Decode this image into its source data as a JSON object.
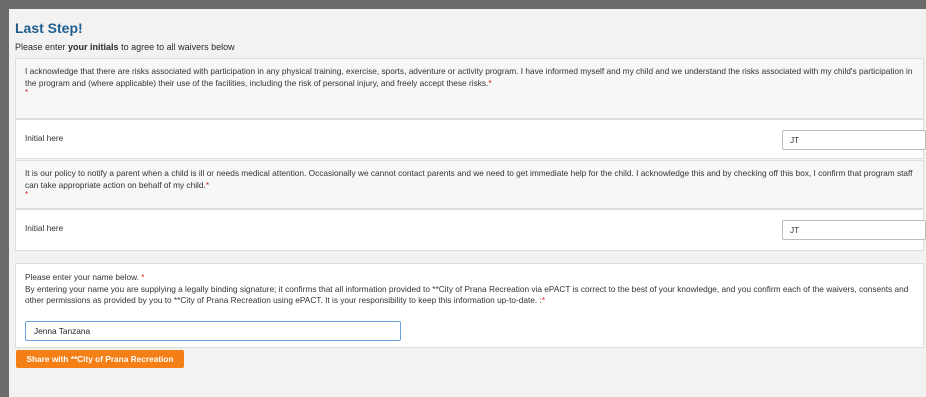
{
  "page": {
    "title": "Last Step!",
    "subtitle_prefix": "Please enter ",
    "subtitle_bold": "your initials",
    "subtitle_suffix": " to agree to all waivers below"
  },
  "waivers": [
    {
      "text": "I acknowledge that there are risks associated with participation in any physical training, exercise, sports, adventure or activity program. I have informed myself and my child and we understand the risks associated with my child's participation in the program and (where applicable) their use of the facilities, including the risk of personal injury, and freely accept these risks.",
      "required_marker": "*",
      "initial_label": "Initial here",
      "initial_value": "JT"
    },
    {
      "text": "It is our policy to notify a parent when a child is ill or needs medical attention. Occasionally we cannot contact parents and we need to get immediate help for the child. I acknowledge this and by checking off this box,  I confirm that program staff can take appropriate action on behalf of my child.",
      "required_marker": "*",
      "initial_label": "Initial here",
      "initial_value": "JT"
    }
  ],
  "signature": {
    "prompt": "Please enter your name below.",
    "required_marker": "*",
    "statement": "By entering your name you are supplying a legally binding signature; it confirms that all information provided to **City of Prana Recreation via ePACT is correct to the best of your knowledge, and you confirm each of the waivers, consents and other permissions as provided by you to **City of Prana Recreation using ePACT. It is your responsibility to keep this information up-to-date. :",
    "statement_marker": "*",
    "name_value": "Jenna Tanzana"
  },
  "actions": {
    "share_label": "Share with **City of Prana Recreation"
  },
  "colors": {
    "title": "#1f5e8e",
    "accent_button": "#f57f17",
    "required": "#d02020"
  }
}
